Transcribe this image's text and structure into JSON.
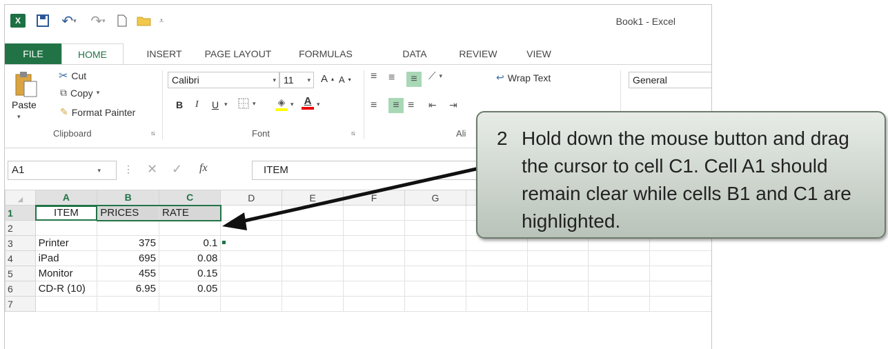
{
  "window": {
    "title": "Book1 - Excel"
  },
  "tabs": [
    "FILE",
    "HOME",
    "INSERT",
    "PAGE LAYOUT",
    "FORMULAS",
    "DATA",
    "REVIEW",
    "VIEW"
  ],
  "clipboard": {
    "paste": "Paste",
    "cut": "Cut",
    "copy": "Copy",
    "format_painter": "Format Painter",
    "label": "Clipboard"
  },
  "font": {
    "name": "Calibri",
    "size": "11",
    "bold": "B",
    "italic": "I",
    "underline": "U",
    "label": "Font"
  },
  "alignment": {
    "wrap_text": "Wrap Text",
    "label": "Ali"
  },
  "number": {
    "format": "General"
  },
  "formula_bar": {
    "name_box": "A1",
    "fx": "fx",
    "content": "ITEM"
  },
  "columns": [
    "A",
    "B",
    "C",
    "D",
    "E",
    "F",
    "G"
  ],
  "rows": [
    {
      "n": "1",
      "a": "ITEM",
      "b": "PRICES",
      "c": "RATE"
    },
    {
      "n": "2",
      "a": "",
      "b": "",
      "c": ""
    },
    {
      "n": "3",
      "a": "Printer",
      "b": "375",
      "c": "0.1"
    },
    {
      "n": "4",
      "a": "iPad",
      "b": "695",
      "c": "0.08"
    },
    {
      "n": "5",
      "a": "Monitor",
      "b": "455",
      "c": "0.15"
    },
    {
      "n": "6",
      "a": "CD-R (10)",
      "b": "6.95",
      "c": "0.05"
    },
    {
      "n": "7",
      "a": "",
      "b": "",
      "c": ""
    }
  ],
  "callout": {
    "number": "2",
    "text": "Hold down the mouse button and drag the cursor to cell C1.  Cell A1 should remain clear while cells B1 and C1 are highlighted."
  },
  "colors": {
    "accent": "#217346",
    "selection": "#d7d7d7"
  }
}
